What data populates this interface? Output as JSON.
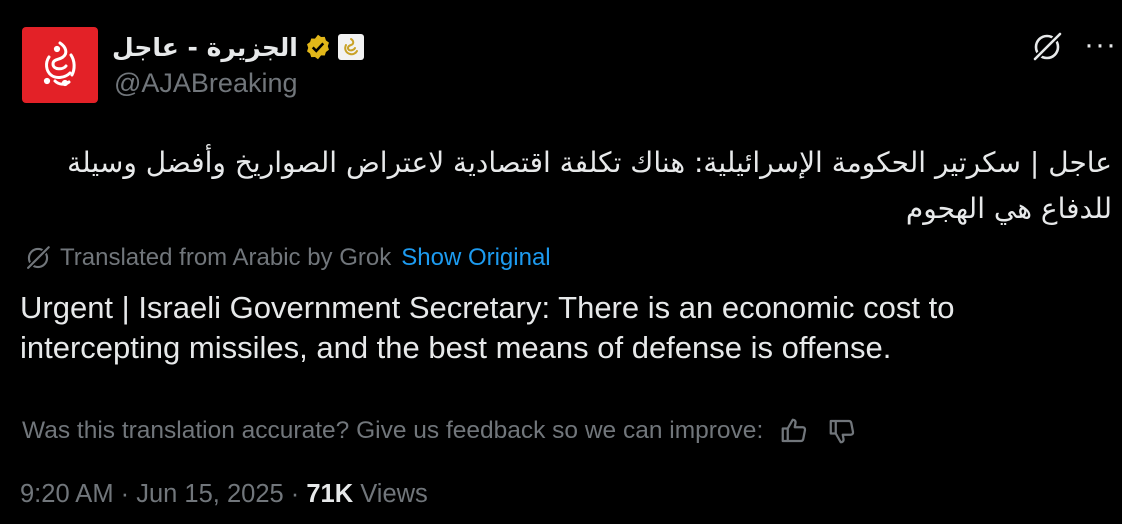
{
  "account": {
    "display_name": "الجزيرة - عاجل",
    "handle": "@AJABreaking",
    "verified_badge_icon": "gold-verified-check-icon",
    "affiliation_badge_icon": "al-jazeera-logo-badge-icon",
    "avatar_icon": "al-jazeera-logo-icon",
    "avatar_color": "#e32127"
  },
  "header_actions": {
    "grok_icon": "grok-icon",
    "more_icon": "more-horizontal-icon",
    "more_label": "···"
  },
  "post": {
    "original_text": "عاجل | سكرتير الحكومة الإسرائيلية: هناك تكلفة اقتصادية لاعتراض الصواريخ وأفضل وسيلة للدفاع هي الهجوم",
    "translation_note": "Translated from Arabic by Grok",
    "show_original_label": "Show Original",
    "translated_text": "Urgent | Israeli Government Secretary: There is an economic cost to intercepting missiles, and the best means of defense is offense."
  },
  "feedback": {
    "prompt": "Was this translation accurate? Give us feedback so we can improve:",
    "thumbs_up_icon": "thumbs-up-icon",
    "thumbs_down_icon": "thumbs-down-icon"
  },
  "meta": {
    "time": "9:20 AM",
    "separator": " · ",
    "date": "Jun 15, 2025",
    "views_count": "71K",
    "views_label": " Views"
  },
  "colors": {
    "background": "#000000",
    "text": "#e7e9ea",
    "muted": "#71767b",
    "link": "#1d9bf0",
    "verified": "#e2b719"
  }
}
